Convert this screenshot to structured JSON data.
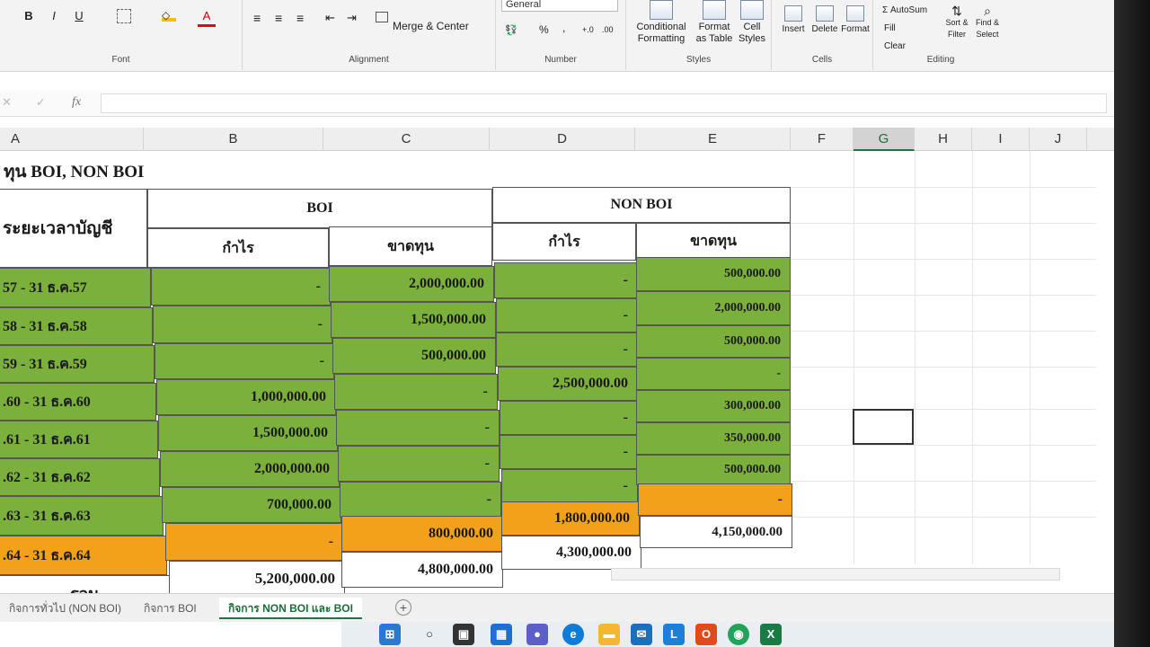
{
  "ribbon": {
    "font_group": "Font",
    "alignment_group": "Alignment",
    "number_group": "Number",
    "styles_group": "Styles",
    "cells_group": "Cells",
    "editing_group": "Editing",
    "bold": "B",
    "italic": "I",
    "underline": "U",
    "font_color": "A",
    "merge_center": "Merge & Center",
    "number_format": "General",
    "percent": "%",
    "comma": ",",
    "conditional_formatting": "Conditional Formatting",
    "format_as_table": "Format as Table",
    "cell_styles": "Cell Styles",
    "insert": "Insert",
    "delete": "Delete",
    "format": "Format",
    "autosum": "Σ AutoSum",
    "fill": "Fill",
    "clear": "Clear",
    "sort_filter": "Sort & Filter",
    "find_select": "Find & Select"
  },
  "formula_bar": {
    "fx": "fx",
    "cancel": "✕",
    "enter": "✓"
  },
  "columns": [
    "A",
    "B",
    "C",
    "D",
    "E",
    "F",
    "G",
    "H",
    "I",
    "J"
  ],
  "sheet": {
    "title": "ทุน BOI, NON BOI",
    "period_header": "ระยะเวลาบัญชี",
    "boi_header": "BOI",
    "nonboi_header": "NON BOI",
    "profit": "กำไร",
    "loss": "ขาดทุน",
    "total_label": "รวม",
    "rows": [
      {
        "period": "57 - 31 ธ.ค.57",
        "boi_profit": "-",
        "boi_loss": "2,000,000.00",
        "non_profit": "-",
        "non_loss": "500,000.00"
      },
      {
        "period": "58 - 31 ธ.ค.58",
        "boi_profit": "-",
        "boi_loss": "1,500,000.00",
        "non_profit": "-",
        "non_loss": "2,000,000.00"
      },
      {
        "period": "59 - 31 ธ.ค.59",
        "boi_profit": "-",
        "boi_loss": "500,000.00",
        "non_profit": "-",
        "non_loss": "500,000.00"
      },
      {
        "period": ".60 - 31 ธ.ค.60",
        "boi_profit": "1,000,000.00",
        "boi_loss": "-",
        "non_profit": "2,500,000.00",
        "non_loss": "-"
      },
      {
        "period": ".61 - 31 ธ.ค.61",
        "boi_profit": "1,500,000.00",
        "boi_loss": "-",
        "non_profit": "-",
        "non_loss": "300,000.00"
      },
      {
        "period": ".62 - 31 ธ.ค.62",
        "boi_profit": "2,000,000.00",
        "boi_loss": "-",
        "non_profit": "-",
        "non_loss": "350,000.00"
      },
      {
        "period": ".63 - 31 ธ.ค.63",
        "boi_profit": "700,000.00",
        "boi_loss": "-",
        "non_profit": "-",
        "non_loss": "500,000.00"
      },
      {
        "period": ".64 - 31 ธ.ค.64",
        "boi_profit": "-",
        "boi_loss": "800,000.00",
        "non_profit": "1,800,000.00",
        "non_loss": "-"
      }
    ],
    "totals": {
      "boi_profit": "5,200,000.00",
      "boi_loss": "4,800,000.00",
      "non_profit": "4,300,000.00",
      "non_loss": "4,150,000.00"
    }
  },
  "tabs": [
    "กิจการทั่วไป (NON BOI)",
    "กิจการ BOI",
    "กิจการ NON BOI และ BOI"
  ],
  "add_sheet": "+"
}
